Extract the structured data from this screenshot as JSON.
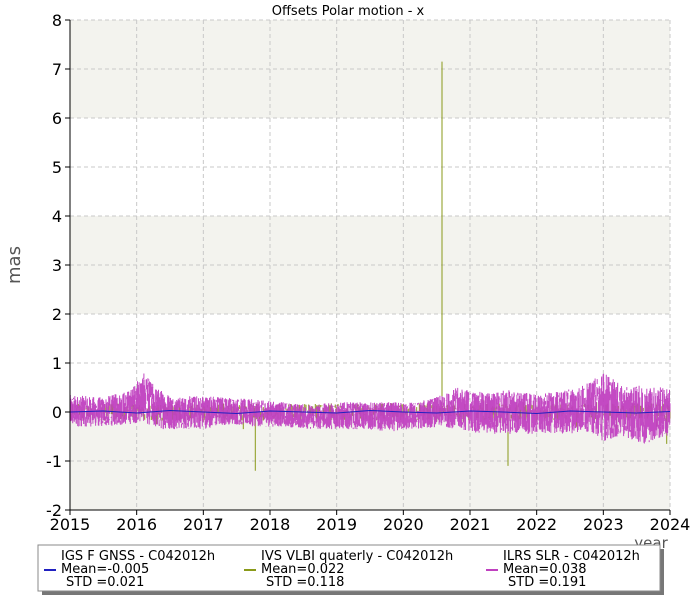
{
  "chart_data": {
    "type": "line",
    "title": "Offsets Polar motion - x",
    "xlabel": "year",
    "ylabel": "mas",
    "xlim": [
      2015,
      2024
    ],
    "ylim": [
      -2,
      8
    ],
    "xticks": [
      "2015",
      "2016",
      "2017",
      "2018",
      "2019",
      "2020",
      "2021",
      "2022",
      "2023",
      "2024"
    ],
    "yticks": [
      "-2",
      "-1",
      "0",
      "1",
      "2",
      "3",
      "4",
      "5",
      "6",
      "7",
      "8"
    ],
    "grid": true,
    "legend_position": "bottom",
    "series": [
      {
        "name": "IGS F GNSS - C042012h",
        "mean": "Mean=-0.005",
        "std": "STD =0.021",
        "color": "#2020c0",
        "points": [
          [
            2015.0,
            0.0
          ],
          [
            2015.5,
            0.02
          ],
          [
            2016.0,
            -0.02
          ],
          [
            2016.5,
            0.03
          ],
          [
            2017.0,
            0.0
          ],
          [
            2017.5,
            -0.03
          ],
          [
            2018.0,
            0.02
          ],
          [
            2018.5,
            0.0
          ],
          [
            2019.0,
            -0.02
          ],
          [
            2019.5,
            0.03
          ],
          [
            2020.0,
            0.0
          ],
          [
            2020.5,
            -0.02
          ],
          [
            2021.0,
            0.02
          ],
          [
            2021.5,
            0.0
          ],
          [
            2022.0,
            -0.03
          ],
          [
            2022.5,
            0.02
          ],
          [
            2023.0,
            0.0
          ],
          [
            2023.5,
            -0.02
          ],
          [
            2024.0,
            0.01
          ]
        ]
      },
      {
        "name": "IVS VLBI quaterly - C042012h",
        "mean": "Mean=0.022",
        "std": "STD =0.118",
        "color": "#8a9a1a",
        "points": [
          [
            2015.0,
            0.05
          ],
          [
            2015.3,
            -0.1
          ],
          [
            2015.6,
            0.15
          ],
          [
            2016.0,
            0.1
          ],
          [
            2016.3,
            -0.25
          ],
          [
            2016.6,
            0.2
          ],
          [
            2017.0,
            -0.2
          ],
          [
            2017.3,
            0.15
          ],
          [
            2017.6,
            -0.35
          ],
          [
            2017.78,
            -1.2
          ],
          [
            2017.9,
            0.1
          ],
          [
            2018.2,
            -0.15
          ],
          [
            2018.5,
            0.1
          ],
          [
            2018.8,
            -0.2
          ],
          [
            2019.0,
            0.1
          ],
          [
            2019.3,
            -0.15
          ],
          [
            2019.6,
            0.12
          ],
          [
            2019.9,
            -0.1
          ],
          [
            2020.2,
            0.1
          ],
          [
            2020.5,
            -0.2
          ],
          [
            2020.58,
            7.15
          ],
          [
            2020.62,
            0.1
          ],
          [
            2020.9,
            -0.2
          ],
          [
            2021.2,
            0.25
          ],
          [
            2021.4,
            -0.3
          ],
          [
            2021.57,
            -1.1
          ],
          [
            2021.8,
            0.2
          ],
          [
            2022.0,
            -0.2
          ],
          [
            2022.3,
            0.25
          ],
          [
            2022.6,
            -0.3
          ],
          [
            2022.9,
            0.2
          ],
          [
            2023.2,
            -0.35
          ],
          [
            2023.5,
            0.15
          ],
          [
            2023.8,
            -0.3
          ],
          [
            2023.95,
            -0.65
          ],
          [
            2024.0,
            0.1
          ]
        ]
      },
      {
        "name": "ILRS SLR - C042012h",
        "mean": "Mean=0.038",
        "std": "STD =0.191",
        "color": "#c040c0",
        "envelope": [
          [
            2015.0,
            0.35,
            -0.3
          ],
          [
            2015.5,
            0.3,
            -0.3
          ],
          [
            2015.9,
            0.45,
            -0.25
          ],
          [
            2016.1,
            0.8,
            -0.2
          ],
          [
            2016.3,
            0.5,
            -0.35
          ],
          [
            2016.6,
            0.3,
            -0.35
          ],
          [
            2017.0,
            0.35,
            -0.35
          ],
          [
            2017.4,
            0.3,
            -0.25
          ],
          [
            2017.8,
            0.25,
            -0.3
          ],
          [
            2018.2,
            0.2,
            -0.3
          ],
          [
            2018.6,
            0.15,
            -0.35
          ],
          [
            2019.0,
            0.2,
            -0.35
          ],
          [
            2019.4,
            0.2,
            -0.35
          ],
          [
            2019.8,
            0.2,
            -0.4
          ],
          [
            2020.2,
            0.2,
            -0.35
          ],
          [
            2020.6,
            0.35,
            -0.3
          ],
          [
            2020.8,
            0.5,
            -0.35
          ],
          [
            2021.2,
            0.4,
            -0.45
          ],
          [
            2021.6,
            0.45,
            -0.45
          ],
          [
            2022.0,
            0.35,
            -0.45
          ],
          [
            2022.4,
            0.45,
            -0.45
          ],
          [
            2022.8,
            0.6,
            -0.4
          ],
          [
            2023.0,
            0.85,
            -0.6
          ],
          [
            2023.3,
            0.5,
            -0.5
          ],
          [
            2023.6,
            0.55,
            -0.65
          ],
          [
            2024.0,
            0.5,
            -0.5
          ]
        ]
      }
    ]
  }
}
